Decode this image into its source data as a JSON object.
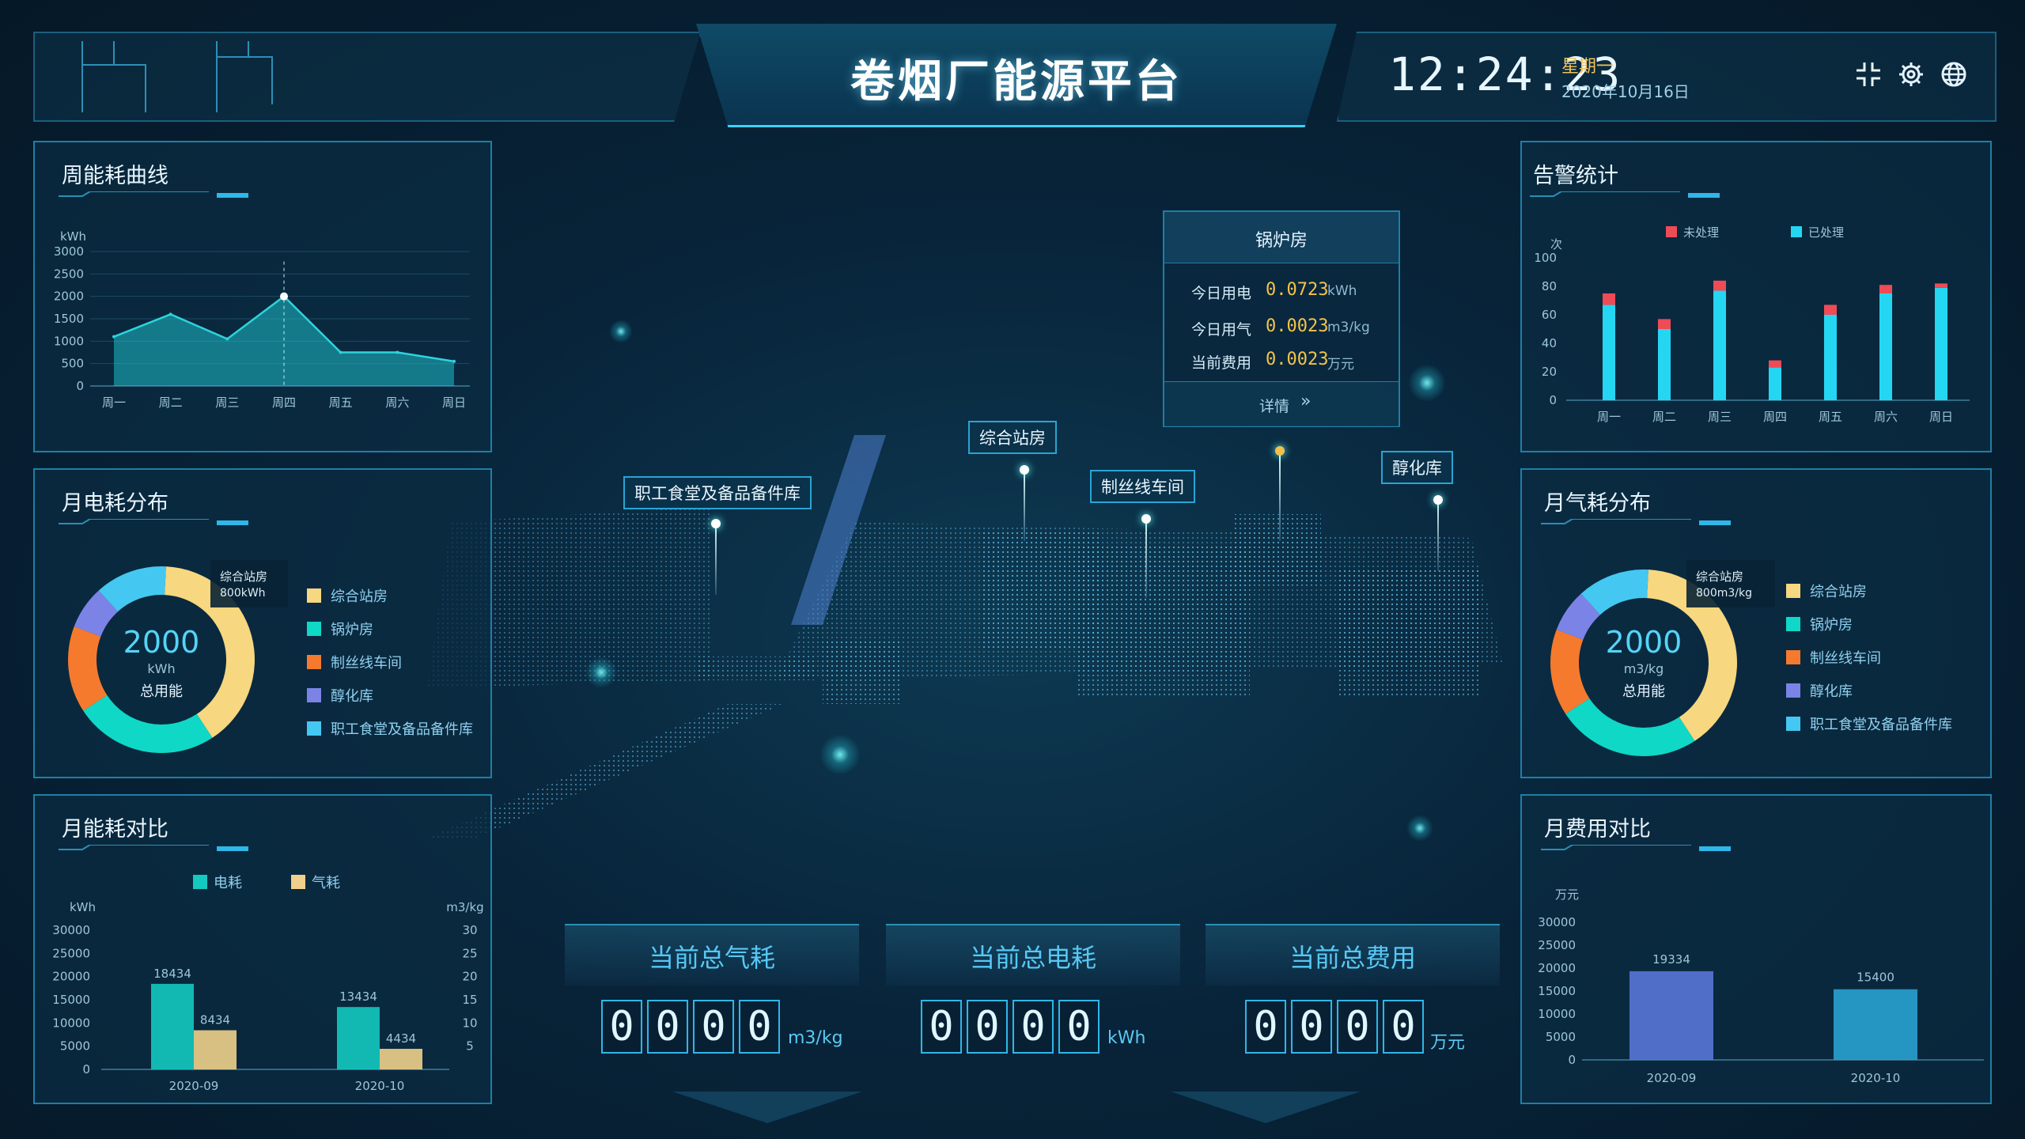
{
  "header": {
    "title": "卷烟厂能源平台",
    "time": "12:24:23",
    "weekday": "星期一",
    "date": "2020年10月16日",
    "icons": [
      "fullscreen-exit-icon",
      "settings-icon",
      "globe-icon"
    ]
  },
  "weekly_energy": {
    "title": "周能耗曲线",
    "chart_data": {
      "type": "area",
      "ylabel": "kWh",
      "categories": [
        "周一",
        "周二",
        "周三",
        "周四",
        "周五",
        "周六",
        "周日"
      ],
      "values": [
        1100,
        1600,
        1050,
        2000,
        750,
        750,
        550
      ],
      "ylim": [
        0,
        3000
      ],
      "yticks": [
        "0",
        "500",
        "1000",
        "1500",
        "2000",
        "2500",
        "3000"
      ],
      "color": "#2fd3dc"
    }
  },
  "monthly_electric": {
    "title": "月电耗分布",
    "center_value": "2000",
    "center_unit": "kWh",
    "center_label": "总用能",
    "tooltip_name": "综合站房",
    "tooltip_value": "800kWh",
    "chart_data": {
      "type": "pie",
      "labels": [
        "综合站房",
        "锅炉房",
        "制丝线车间",
        "醇化库",
        "职工食堂及备品备件库"
      ],
      "values": [
        800,
        500,
        300,
        150,
        250
      ],
      "colors": [
        "#f7d77f",
        "#0fd8c6",
        "#f57a2e",
        "#7b84e6",
        "#44c8f2"
      ]
    }
  },
  "monthly_compare": {
    "title": "月能耗对比",
    "legend": [
      "电耗",
      "气耗"
    ],
    "ylabel_left": "kWh",
    "ylabel_right": "m3/kg",
    "chart_data": {
      "type": "bar",
      "categories": [
        "2020-09",
        "2020-10"
      ],
      "series": [
        {
          "name": "电耗",
          "values": [
            18434,
            13434
          ],
          "color": "#14c9c0"
        },
        {
          "name": "气耗",
          "values": [
            8434,
            4434
          ],
          "color": "#f0d08a"
        }
      ],
      "ylim": [
        0,
        30000
      ],
      "yticks_left": [
        "0",
        "5000",
        "10000",
        "15000",
        "20000",
        "25000",
        "30000"
      ],
      "yticks_right": [
        "5",
        "10",
        "15",
        "20",
        "25",
        "30"
      ]
    }
  },
  "alarm_stats": {
    "title": "告警统计",
    "ylabel": "次",
    "legend": [
      "未处理",
      "已处理"
    ],
    "chart_data": {
      "type": "bar",
      "categories": [
        "周一",
        "周二",
        "周三",
        "周四",
        "周五",
        "周六",
        "周日"
      ],
      "series": [
        {
          "name": "已处理",
          "values": [
            67,
            50,
            77,
            23,
            60,
            75,
            79
          ],
          "color": "#25d6f2"
        },
        {
          "name": "未处理",
          "values": [
            8,
            7,
            7,
            5,
            7,
            6,
            3
          ],
          "color": "#ef4b56"
        }
      ],
      "ylim": [
        0,
        100
      ],
      "yticks": [
        "0",
        "20",
        "40",
        "60",
        "80",
        "100"
      ]
    }
  },
  "monthly_gas": {
    "title": "月气耗分布",
    "center_value": "2000",
    "center_unit": "m3/kg",
    "center_label": "总用能",
    "tooltip_name": "综合站房",
    "tooltip_value": "800m3/kg",
    "chart_data": {
      "type": "pie",
      "labels": [
        "综合站房",
        "锅炉房",
        "制丝线车间",
        "醇化库",
        "职工食堂及备品备件库"
      ],
      "values": [
        800,
        500,
        300,
        150,
        250
      ],
      "colors": [
        "#f7d77f",
        "#0fd8c6",
        "#f57a2e",
        "#7b84e6",
        "#44c8f2"
      ]
    }
  },
  "monthly_cost": {
    "title": "月费用对比",
    "ylabel": "万元",
    "chart_data": {
      "type": "bar",
      "categories": [
        "2020-09",
        "2020-10"
      ],
      "values": [
        19334,
        15400
      ],
      "colors": [
        "#5d79e0",
        "#2aa8d8"
      ],
      "ylim": [
        0,
        30000
      ],
      "yticks": [
        "0",
        "5000",
        "10000",
        "15000",
        "20000",
        "25000",
        "30000"
      ]
    }
  },
  "popup": {
    "title": "锅炉房",
    "rows": [
      {
        "label": "今日用电",
        "value": "0.0723",
        "unit": "kWh"
      },
      {
        "label": "今日用气",
        "value": "0.0023",
        "unit": "m3/kg"
      },
      {
        "label": "当前费用",
        "value": "0.0023",
        "unit": "万元"
      }
    ],
    "detail": "详情"
  },
  "map_labels": {
    "canteen": "职工食堂及备品备件库",
    "station": "综合站房",
    "wire": "制丝线车间",
    "aging": "醇化库"
  },
  "counters": [
    {
      "title": "当前总气耗",
      "digits": [
        "0",
        "0",
        "0",
        "0"
      ],
      "unit": "m3/kg"
    },
    {
      "title": "当前总电耗",
      "digits": [
        "0",
        "0",
        "0",
        "0"
      ],
      "unit": "kWh"
    },
    {
      "title": "当前总费用",
      "digits": [
        "0",
        "0",
        "0",
        "0"
      ],
      "unit": "万元"
    }
  ]
}
